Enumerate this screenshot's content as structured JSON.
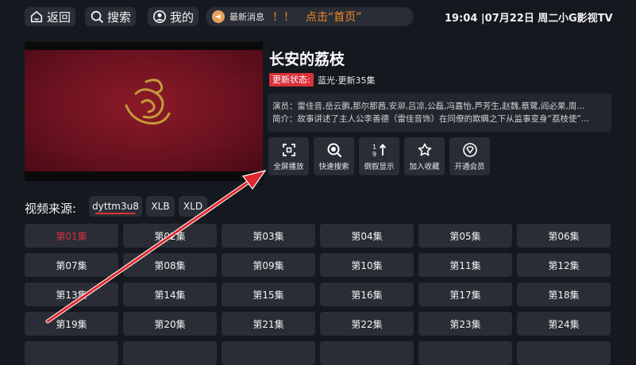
{
  "topbar": {
    "back_label": "返回",
    "search_label": "搜索",
    "mine_label": "我的",
    "notice": {
      "title": "最新消息",
      "marks": "！！",
      "text": "点击“首页”"
    },
    "clock": "19:04 |07月22日 周二",
    "brand": "小G影视TV"
  },
  "detail": {
    "title": "长安的荔枝",
    "status_label": "更新状态:",
    "status_value": "蓝光·更新35集",
    "cast": "演员：雷佳音,岳云鹏,那尔那茜,安泖,吕凉,公磊,冯嘉怡,芦芳生,赵魏,蔡鹭,阎必果,周...",
    "synopsis": "简介：故事讲述了主人公李善德（雷佳音饰）在同僚的欺瞒之下从监事变身“荔枝使”..."
  },
  "actions": [
    {
      "label": "全屏播放",
      "icon": "fullscreen-icon"
    },
    {
      "label": "快速搜索",
      "icon": "search-icon"
    },
    {
      "label": "倒叙显示",
      "icon": "sort-order-icon"
    },
    {
      "label": "加入收藏",
      "icon": "star-icon"
    },
    {
      "label": "开通会员",
      "icon": "vip-diamond-icon"
    }
  ],
  "sources": {
    "label": "视频来源:",
    "items": [
      "dyttm3u8",
      "XLB",
      "XLD"
    ],
    "selected": "dyttm3u8"
  },
  "episodes": {
    "selected": "第01集",
    "items": [
      "第01集",
      "第02集",
      "第03集",
      "第04集",
      "第05集",
      "第06集",
      "第07集",
      "第08集",
      "第09集",
      "第10集",
      "第11集",
      "第12集",
      "第13集",
      "第14集",
      "第15集",
      "第16集",
      "第17集",
      "第18集",
      "第19集",
      "第20集",
      "第21集",
      "第22集",
      "第23集",
      "第24集"
    ]
  },
  "colors": {
    "accent": "#d8313a",
    "notice": "#f08a2a",
    "tile": "#2a2d35",
    "background": "#15181f"
  }
}
